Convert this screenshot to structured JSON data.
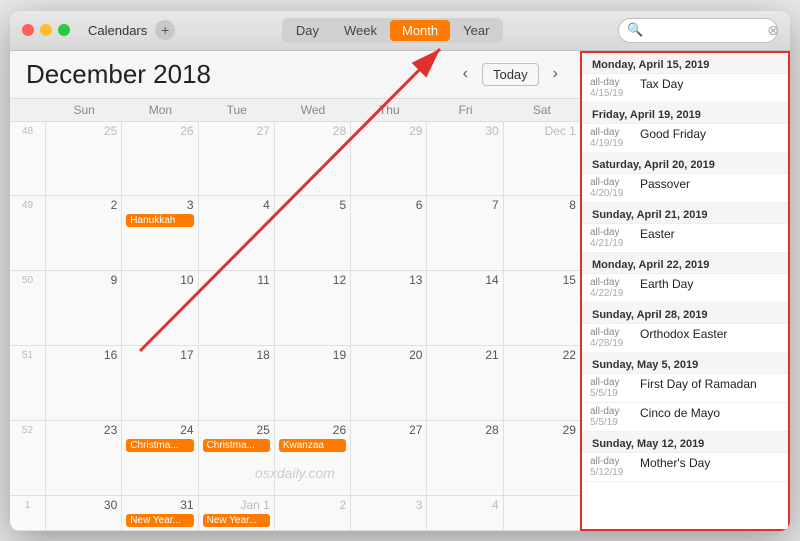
{
  "window": {
    "title": "Calendars"
  },
  "titlebar": {
    "calendars_label": "Calendars",
    "add_label": "+",
    "view_tabs": [
      "Day",
      "Week",
      "Month",
      "Year"
    ],
    "active_tab": "Month",
    "search_placeholder": ""
  },
  "calendar": {
    "month_year": "December 2018",
    "nav_prev": "‹",
    "nav_next": "›",
    "today_label": "Today",
    "day_headers": [
      "Sun",
      "Mon",
      "Tue",
      "Wed",
      "Thu",
      "Fri",
      "Sat"
    ],
    "watermark": "osxdaily.com",
    "weeks": [
      {
        "week_num": "48",
        "days": [
          {
            "num": "25",
            "type": "other"
          },
          {
            "num": "26",
            "type": "other"
          },
          {
            "num": "27",
            "type": "other"
          },
          {
            "num": "28",
            "type": "other"
          },
          {
            "num": "29",
            "type": "other"
          },
          {
            "num": "30",
            "type": "other"
          },
          {
            "num": "Dec 1",
            "type": "other"
          }
        ]
      },
      {
        "week_num": "49",
        "days": [
          {
            "num": "2",
            "type": "normal"
          },
          {
            "num": "3",
            "type": "normal",
            "events": [
              "Hanukkah"
            ]
          },
          {
            "num": "4",
            "type": "normal"
          },
          {
            "num": "5",
            "type": "normal"
          },
          {
            "num": "6",
            "type": "normal"
          },
          {
            "num": "7",
            "type": "normal"
          },
          {
            "num": "8",
            "type": "normal"
          }
        ]
      },
      {
        "week_num": "50",
        "days": [
          {
            "num": "9",
            "type": "normal"
          },
          {
            "num": "10",
            "type": "normal"
          },
          {
            "num": "11",
            "type": "normal"
          },
          {
            "num": "12",
            "type": "normal"
          },
          {
            "num": "13",
            "type": "normal"
          },
          {
            "num": "14",
            "type": "normal"
          },
          {
            "num": "15",
            "type": "normal"
          }
        ]
      },
      {
        "week_num": "51",
        "days": [
          {
            "num": "16",
            "type": "normal"
          },
          {
            "num": "17",
            "type": "normal"
          },
          {
            "num": "18",
            "type": "normal"
          },
          {
            "num": "19",
            "type": "normal"
          },
          {
            "num": "20",
            "type": "normal"
          },
          {
            "num": "21",
            "type": "normal"
          },
          {
            "num": "22",
            "type": "normal"
          }
        ]
      },
      {
        "week_num": "52",
        "days": [
          {
            "num": "23",
            "type": "normal"
          },
          {
            "num": "24",
            "type": "normal",
            "events": [
              "Christma..."
            ]
          },
          {
            "num": "25",
            "type": "normal",
            "events": [
              "Christma..."
            ]
          },
          {
            "num": "26",
            "type": "normal",
            "events": [
              "Kwanzaa"
            ]
          },
          {
            "num": "27",
            "type": "normal"
          },
          {
            "num": "28",
            "type": "normal"
          },
          {
            "num": "29",
            "type": "normal"
          }
        ]
      },
      {
        "week_num": "1",
        "days": [
          {
            "num": "30",
            "type": "normal"
          },
          {
            "num": "31",
            "type": "normal",
            "events": [
              "New Year..."
            ]
          },
          {
            "num": "Jan 1",
            "type": "other",
            "events": [
              "New Year..."
            ]
          },
          {
            "num": "2",
            "type": "other"
          },
          {
            "num": "3",
            "type": "other"
          },
          {
            "num": "4",
            "type": "other"
          },
          {
            "num": "",
            "type": "other"
          }
        ]
      }
    ]
  },
  "search_results": {
    "groups": [
      {
        "header": "Monday, April 15, 2019",
        "items": [
          {
            "allday": "all-day",
            "date": "4/15/19",
            "name": "Tax Day"
          }
        ]
      },
      {
        "header": "Friday, April 19, 2019",
        "items": [
          {
            "allday": "all-day",
            "date": "4/19/19",
            "name": "Good Friday"
          }
        ]
      },
      {
        "header": "Saturday, April 20, 2019",
        "items": [
          {
            "allday": "all-day",
            "date": "4/20/19",
            "name": "Passover"
          }
        ]
      },
      {
        "header": "Sunday, April 21, 2019",
        "items": [
          {
            "allday": "all-day",
            "date": "4/21/19",
            "name": "Easter"
          }
        ]
      },
      {
        "header": "Monday, April 22, 2019",
        "items": [
          {
            "allday": "all-day",
            "date": "4/22/19",
            "name": "Earth Day"
          }
        ]
      },
      {
        "header": "Sunday, April 28, 2019",
        "items": [
          {
            "allday": "all-day",
            "date": "4/28/19",
            "name": "Orthodox Easter"
          }
        ]
      },
      {
        "header": "Sunday, May 5, 2019",
        "items": [
          {
            "allday": "all-day",
            "date": "5/5/19",
            "name": "First Day of Ramadan"
          },
          {
            "allday": "all-day",
            "date": "5/5/19",
            "name": "Cinco de Mayo"
          }
        ]
      },
      {
        "header": "Sunday, May 12, 2019",
        "items": [
          {
            "allday": "all-day",
            "date": "5/12/19",
            "name": "Mother's Day"
          }
        ]
      }
    ]
  }
}
